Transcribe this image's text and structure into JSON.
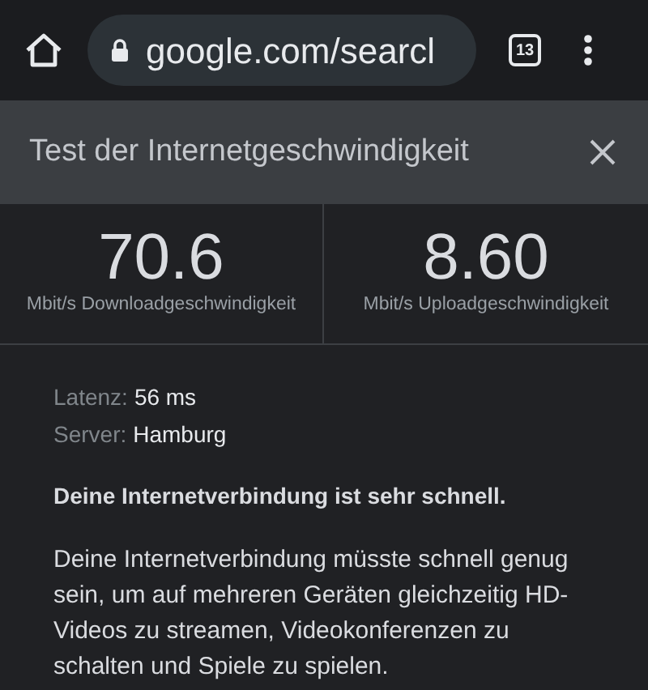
{
  "toolbar": {
    "url": "google.com/searcl",
    "tab_count": "13"
  },
  "panel": {
    "title": "Test der Internetgeschwindigkeit"
  },
  "metrics": [
    {
      "value": "70.6",
      "label": "Mbit/s Downloadgeschwindigkeit"
    },
    {
      "value": "8.60",
      "label": "Mbit/s Uploadgeschwindigkeit"
    }
  ],
  "details": [
    {
      "label": "Latenz:",
      "value": "56 ms"
    },
    {
      "label": "Server:",
      "value": "Hamburg"
    }
  ],
  "summary": "Deine Internetverbindung ist sehr schnell.",
  "description": "Deine Internetverbindung müsste schnell genug sein, um auf mehreren Geräten gleichzeitig HD-Videos zu streamen, Videokonferenzen zu schalten und Spiele zu spielen."
}
